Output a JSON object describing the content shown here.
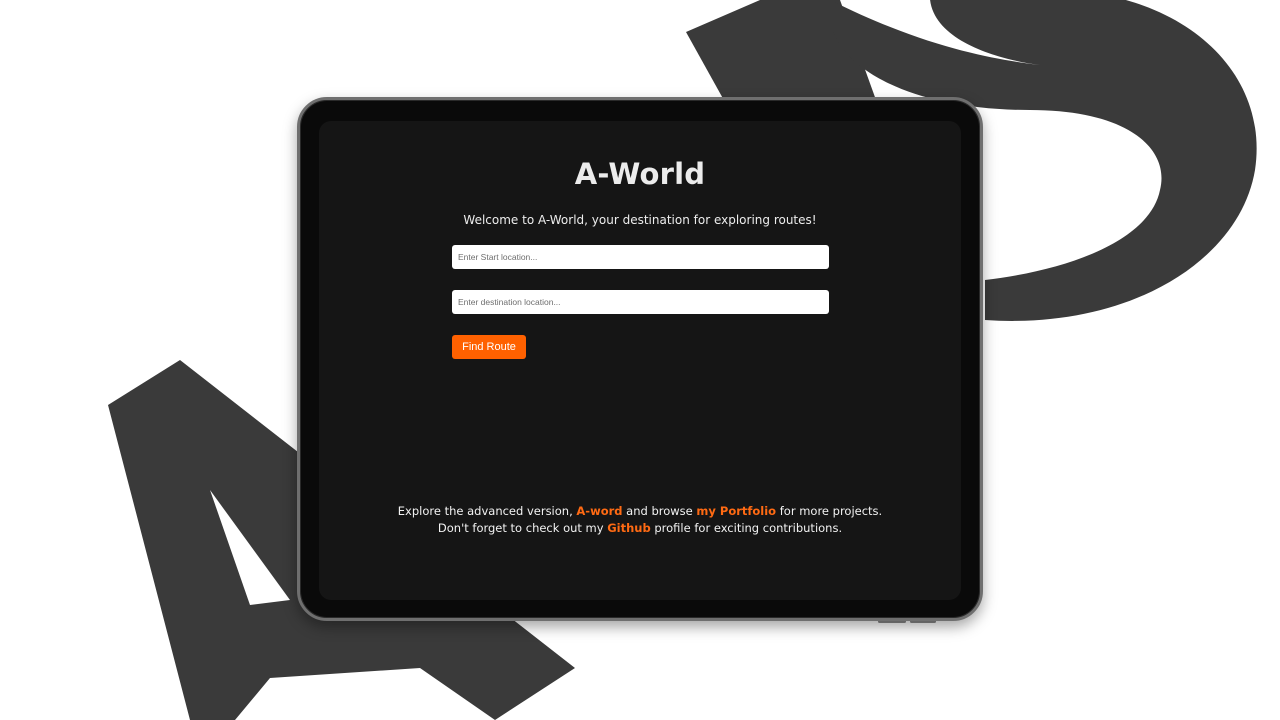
{
  "app": {
    "title": "A-World",
    "welcome": "Welcome to A-World, your destination for exploring routes!"
  },
  "form": {
    "start_placeholder": "Enter Start location...",
    "destination_placeholder": "Enter destination location...",
    "find_button": "Find Route"
  },
  "footer": {
    "line1_pre": "Explore the advanced version,",
    "line1_link1": "A-word",
    "line1_mid": "and browse",
    "line1_link2": "my Portfolio",
    "line1_post": "for more projects.",
    "line2_pre": "Don't forget to check out my",
    "line2_link": "Github",
    "line2_post": "profile for exciting contributions."
  },
  "colors": {
    "accent": "#ff6100",
    "screen_bg": "#151515",
    "page_bg": "#ffffff",
    "art": "#3a3a3a"
  }
}
